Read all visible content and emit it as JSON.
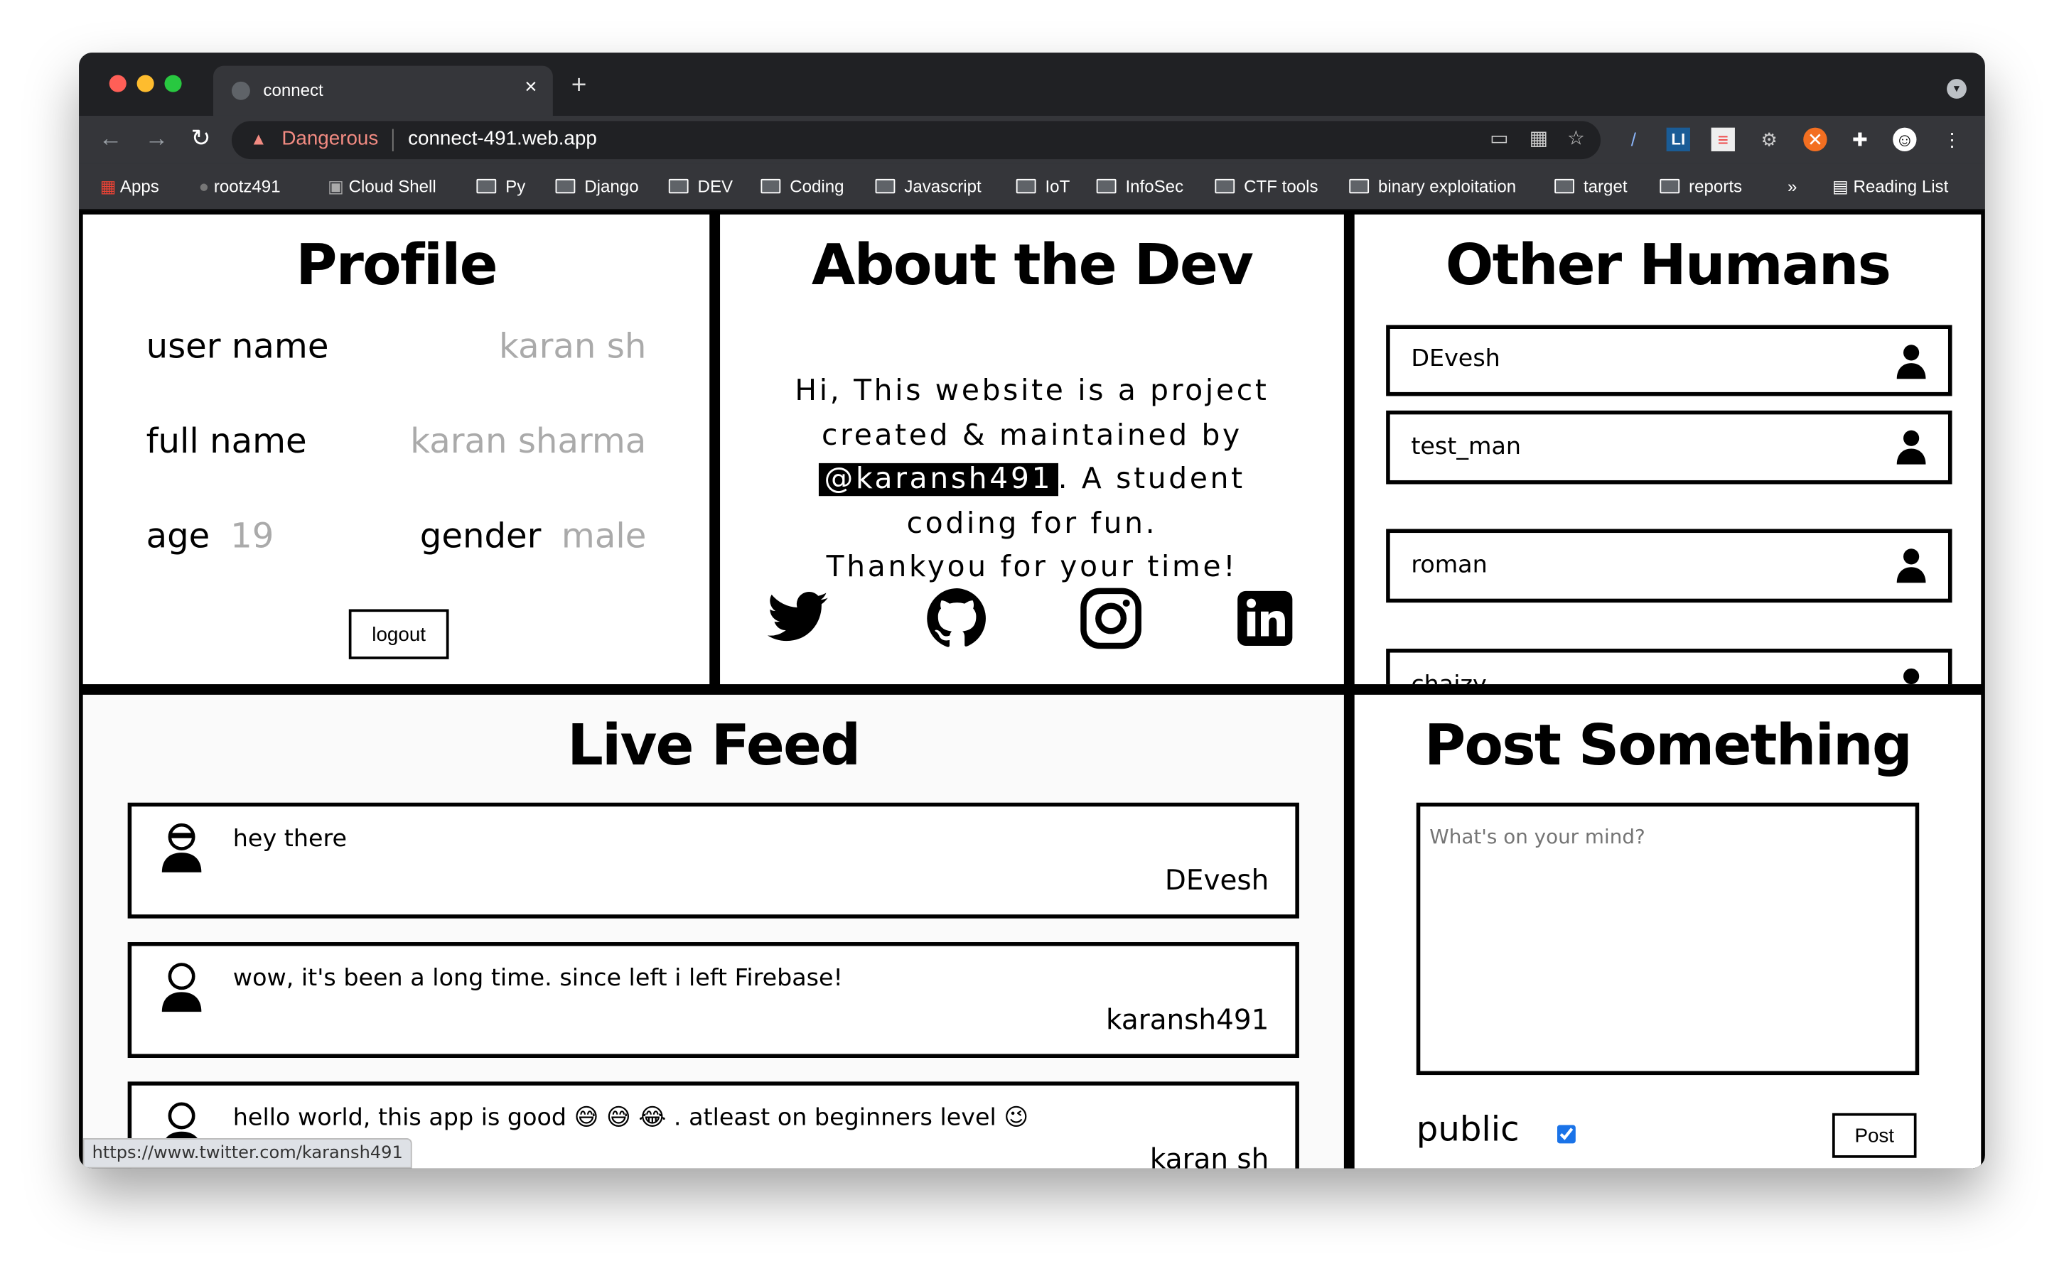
{
  "browser": {
    "tab_title": "connect",
    "security_label": "Dangerous",
    "url": "connect-491.web.app",
    "bookmarks": [
      "Apps",
      "rootz491",
      "Cloud Shell",
      "Py",
      "Django",
      "DEV",
      "Coding",
      "Javascript",
      "IoT",
      "InfoSec",
      "CTF tools",
      "binary exploitation",
      "target",
      "reports"
    ],
    "overflow": "»",
    "reading_list": "Reading List",
    "status_url": "https://www.twitter.com/karansh491",
    "colors": {
      "frame": "#202124",
      "toolbar": "#35363a",
      "danger": "#f28b82"
    }
  },
  "profile": {
    "title": "Profile",
    "username_label": "user name",
    "username": "karan sh",
    "fullname_label": "full name",
    "fullname": "karan sharma",
    "age_label": "age",
    "age": "19",
    "gender_label": "gender",
    "gender": "male",
    "logout": "logout"
  },
  "about": {
    "title": "About the Dev",
    "line1": "Hi, This website is a project",
    "line2": "created & maintained by",
    "handle": "@karansh491",
    "line3_rest": ". A student",
    "line4": "coding for fun.",
    "line5": "Thankyou for your time!",
    "socials": [
      "twitter-icon",
      "github-icon",
      "instagram-icon",
      "linkedin-icon"
    ]
  },
  "humans": {
    "title": "Other Humans",
    "users": [
      "DEvesh",
      "test_man",
      "roman",
      "chaizy"
    ]
  },
  "feed": {
    "title": "Live Feed",
    "posts": [
      {
        "text": "hey there",
        "author": "DEvesh"
      },
      {
        "text": "wow, it's been a long time. since left i left Firebase!",
        "author": "karansh491"
      },
      {
        "text": "hello world, this app is good 😅 😅 😂 . atleast on beginners level 😉",
        "author": "karan sh"
      }
    ]
  },
  "compose": {
    "title": "Post Something",
    "placeholder": "What's on your mind?",
    "public_label": "public",
    "public_checked": true,
    "post_button": "Post"
  }
}
